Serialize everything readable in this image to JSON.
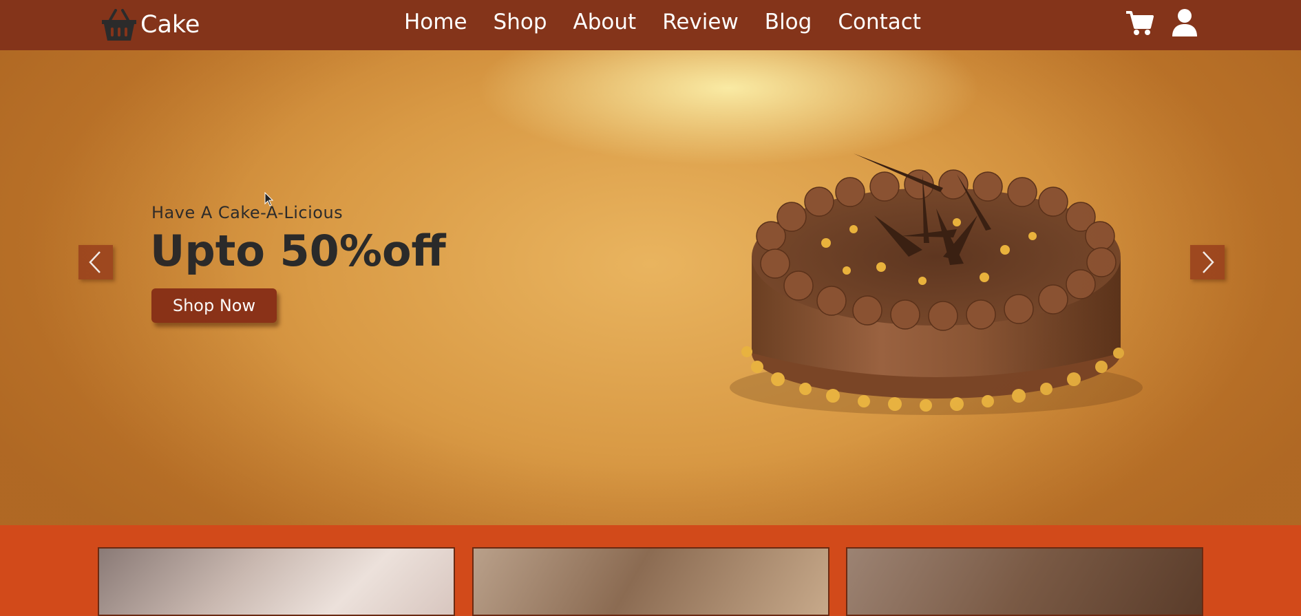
{
  "nav": {
    "logo_text": "Cake",
    "logo_icon": "basket-icon",
    "menu": [
      {
        "label": "Home"
      },
      {
        "label": "Shop"
      },
      {
        "label": "About"
      },
      {
        "label": "Review"
      },
      {
        "label": "Blog"
      },
      {
        "label": "Contact"
      }
    ],
    "icons": [
      "cart-icon",
      "user-icon"
    ]
  },
  "hero": {
    "subtitle": "Have A Cake-A-Licious",
    "title": "Upto 50%off",
    "button_label": "Shop Now",
    "prev_icon": "chevron-left-icon",
    "next_icon": "chevron-right-icon"
  },
  "products": [
    {
      "name": "bride-cake-card"
    },
    {
      "name": "cherry-cake-card"
    },
    {
      "name": "blackcurrant-cake-card"
    }
  ],
  "colors": {
    "nav_bg": "#84341a",
    "button_bg": "#8a3218",
    "strip_bg": "#d24a1a",
    "arrow_bg": "#a24a21"
  }
}
